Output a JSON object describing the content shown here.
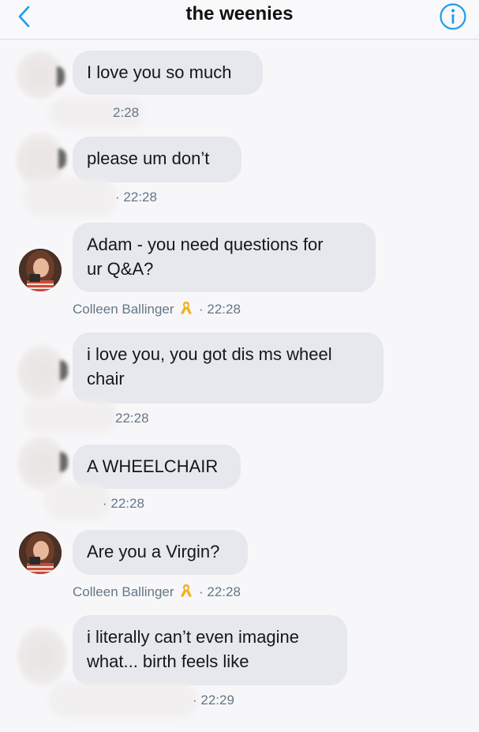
{
  "header": {
    "title": "the weenies",
    "back_icon": "chevron-left-icon",
    "info_icon": "info-circle-icon",
    "accent": "#1d9bf0"
  },
  "messages": [
    {
      "text": "I love you so much",
      "time": "2:28",
      "sender": ""
    },
    {
      "text": "please um don’t",
      "time": "· 22:28",
      "sender": ""
    },
    {
      "line1": "Adam - you need questions for",
      "line2": "ur Q&A?",
      "time": "· 22:28",
      "sender": "Colleen Ballinger"
    },
    {
      "line1": "i love you, you got dis ms wheel",
      "line2": "chair",
      "time": "22:28",
      "sender": ""
    },
    {
      "text": "A WHEELCHAIR",
      "time": "· 22:28",
      "sender": ""
    },
    {
      "text": "Are you a Virgin?",
      "time": "· 22:28",
      "sender": "Colleen Ballinger"
    },
    {
      "line1": "i literally can’t even imagine",
      "line2": "what... birth feels like",
      "time": "· 22:29",
      "sender": ""
    }
  ]
}
